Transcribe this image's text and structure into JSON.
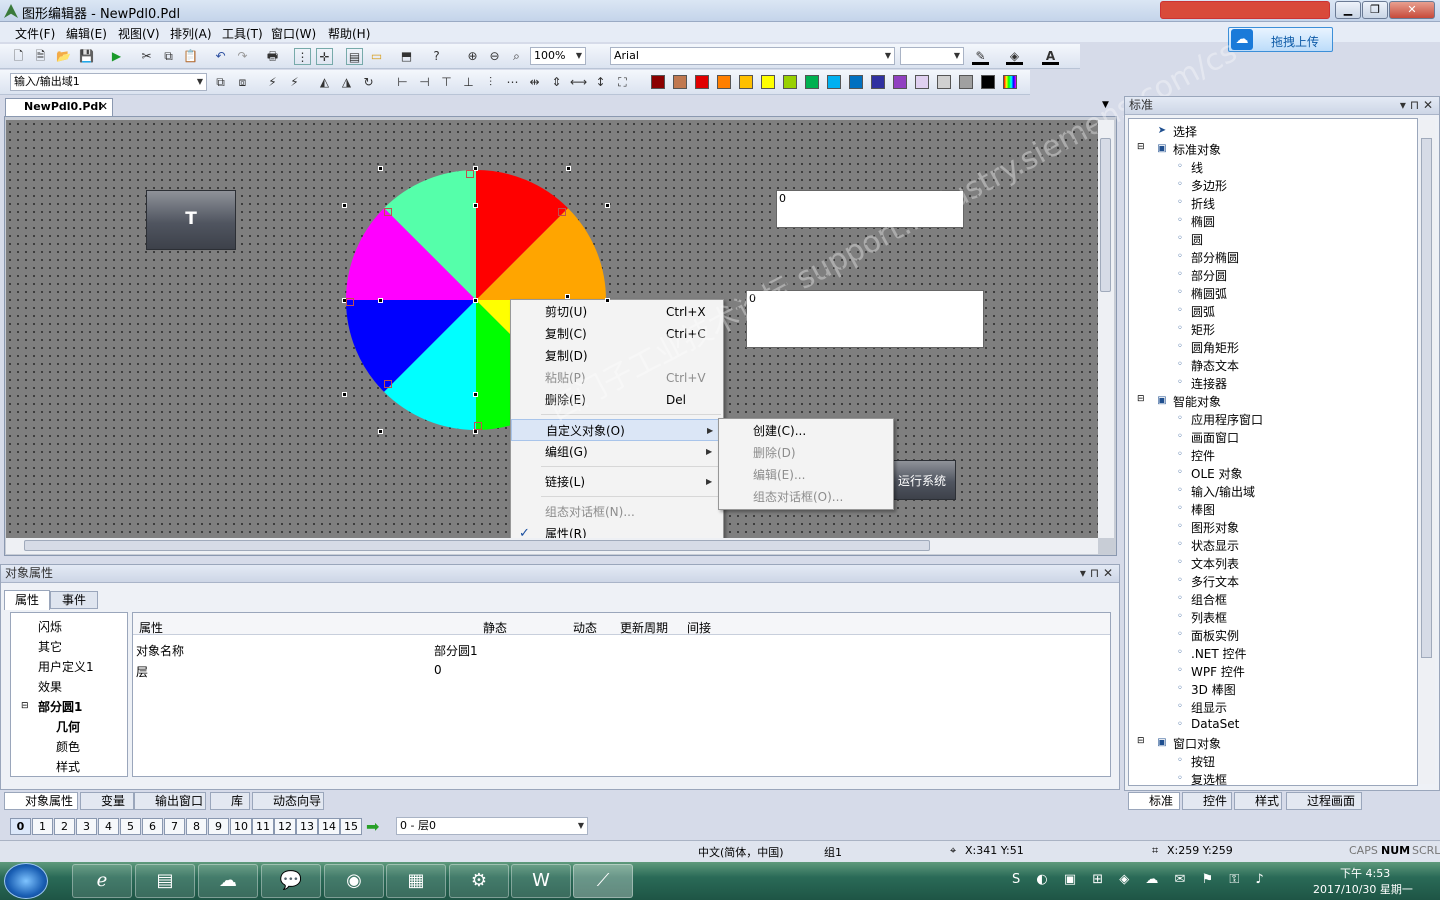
{
  "window": {
    "title": "图形编辑器 - NewPdl0.Pdl"
  },
  "menubar": [
    "文件(F)",
    "编辑(E)",
    "视图(V)",
    "排列(A)",
    "工具(T)",
    "窗口(W)",
    "帮助(H)"
  ],
  "upload_label": "拖拽上传",
  "toolbar1": {
    "zoom": "100%",
    "font": "Arial"
  },
  "toolbar2": {
    "layer_combo": "输入/输出域1"
  },
  "palette": [
    "#8b0000",
    "#c07850",
    "#e00000",
    "#ff7f00",
    "#ffc000",
    "#ffff00",
    "#98d000",
    "#00b050",
    "#00b0f0",
    "#0070c0",
    "#3030a0",
    "#9040c0",
    "#e0d0f0",
    "#d0d0d0",
    "#a0a0a0",
    "#000000",
    "#ffffff"
  ],
  "doc_tab": "NewPdl0.Pdl",
  "canvas": {
    "button_t": "T",
    "io_field1": "0",
    "io_field2": "0",
    "run_button": "运行系统",
    "pie_slices": [
      "#00ff00",
      "#ffff00",
      "#ffa500",
      "#ff0000",
      "#55ffaa",
      "#ff00ff",
      "#0000ff",
      "#00ffff"
    ]
  },
  "context_menu": [
    {
      "label": "剪切(U)",
      "shortcut": "Ctrl+X",
      "enabled": true
    },
    {
      "label": "复制(C)",
      "shortcut": "Ctrl+C",
      "enabled": true
    },
    {
      "label": "复制(D)",
      "shortcut": "",
      "enabled": true
    },
    {
      "label": "粘贴(P)",
      "shortcut": "Ctrl+V",
      "enabled": false
    },
    {
      "label": "删除(E)",
      "shortcut": "Del",
      "enabled": true
    },
    {
      "label": "自定义对象(O)",
      "shortcut": "",
      "enabled": true
    },
    {
      "label": "编组(G)",
      "shortcut": "",
      "enabled": true
    },
    {
      "label": "链接(L)",
      "shortcut": "",
      "enabled": true
    },
    {
      "label": "组态对话框(N)...",
      "shortcut": "",
      "enabled": false
    },
    {
      "label": "属性(R)",
      "shortcut": "",
      "enabled": true
    }
  ],
  "submenu": [
    {
      "label": "创建(C)...",
      "enabled": true
    },
    {
      "label": "删除(D)",
      "enabled": false
    },
    {
      "label": "编辑(E)...",
      "enabled": false
    },
    {
      "label": "组态对话框(O)...",
      "enabled": false
    }
  ],
  "watermark": "西门子工业技术论坛 support.industry.siemens.com/cs",
  "prop_panel": {
    "title": "对象属性",
    "tabs": [
      "属性",
      "事件"
    ],
    "tree": [
      "闪烁",
      "其它",
      "用户定义1",
      "效果",
      "部分圆1",
      "几何",
      "颜色",
      "样式"
    ],
    "columns": [
      "属性",
      "静态",
      "动态",
      "更新周期",
      "间接"
    ],
    "rows": [
      [
        "对象名称",
        "部分圆1"
      ],
      [
        "层",
        "0"
      ]
    ]
  },
  "bottom_tabs": [
    "对象属性",
    "变量",
    "输出窗口",
    "库",
    "动态向导"
  ],
  "layer_bar": {
    "layers": [
      "0",
      "1",
      "2",
      "3",
      "4",
      "5",
      "6",
      "7",
      "8",
      "9",
      "10",
      "11",
      "12",
      "13",
      "14",
      "15"
    ],
    "layer_select": "0 - 层0"
  },
  "right_panel": {
    "title": "标准",
    "items": [
      [
        "选择",
        0
      ],
      [
        "标准对象",
        0
      ],
      [
        "线",
        1
      ],
      [
        "多边形",
        1
      ],
      [
        "折线",
        1
      ],
      [
        "椭圆",
        1
      ],
      [
        "圆",
        1
      ],
      [
        "部分椭圆",
        1
      ],
      [
        "部分圆",
        1
      ],
      [
        "椭圆弧",
        1
      ],
      [
        "圆弧",
        1
      ],
      [
        "矩形",
        1
      ],
      [
        "圆角矩形",
        1
      ],
      [
        "静态文本",
        1
      ],
      [
        "连接器",
        1
      ],
      [
        "智能对象",
        0
      ],
      [
        "应用程序窗口",
        1
      ],
      [
        "画面窗口",
        1
      ],
      [
        "控件",
        1
      ],
      [
        "OLE 对象",
        1
      ],
      [
        "输入/输出域",
        1
      ],
      [
        "棒图",
        1
      ],
      [
        "图形对象",
        1
      ],
      [
        "状态显示",
        1
      ],
      [
        "文本列表",
        1
      ],
      [
        "多行文本",
        1
      ],
      [
        "组合框",
        1
      ],
      [
        "列表框",
        1
      ],
      [
        "面板实例",
        1
      ],
      [
        ".NET 控件",
        1
      ],
      [
        "WPF 控件",
        1
      ],
      [
        "3D 棒图",
        1
      ],
      [
        "组显示",
        1
      ],
      [
        "DataSet",
        1
      ],
      [
        "窗口对象",
        0
      ],
      [
        "按钮",
        1
      ],
      [
        "复选框",
        1
      ]
    ],
    "tabs": [
      "标准",
      "控件",
      "样式",
      "过程画面"
    ]
  },
  "statusbar": {
    "lang": "中文(简体，中国)",
    "group": "组1",
    "pos": "X:341 Y:51",
    "size": "X:259 Y:259",
    "caps": "CAPS",
    "num": "NUM",
    "scrl": "SCRL"
  },
  "taskbar": {
    "time": "下午 4:53",
    "date": "2017/10/30 星期一"
  }
}
